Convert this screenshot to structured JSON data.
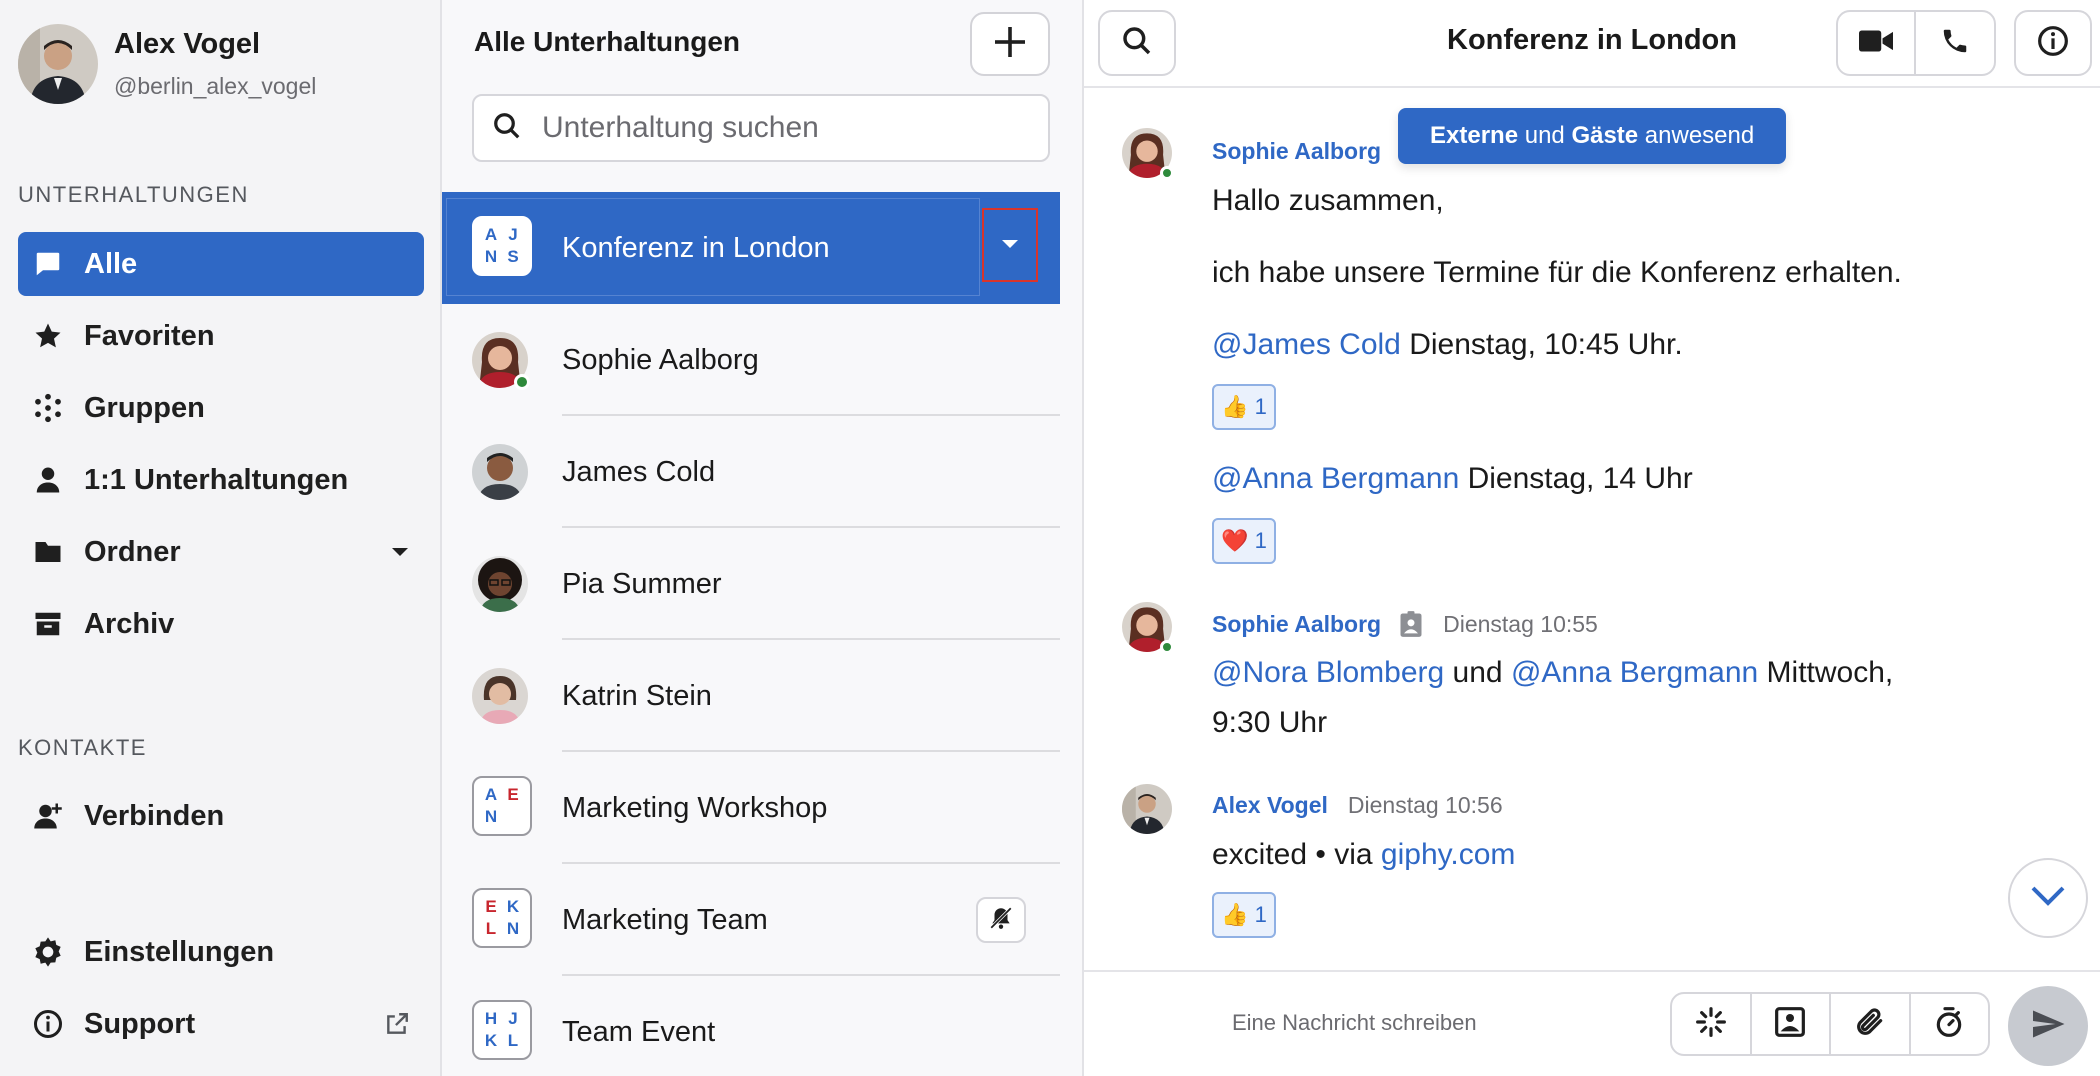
{
  "profile": {
    "name": "Alex Vogel",
    "handle": "@berlin_alex_vogel"
  },
  "sidebar": {
    "section_conversations": "UNTERHALTUNGEN",
    "items": [
      {
        "label": "Alle",
        "icon": "chat-bubble-icon",
        "active": true
      },
      {
        "label": "Favoriten",
        "icon": "star-icon"
      },
      {
        "label": "Gruppen",
        "icon": "groups-icon"
      },
      {
        "label": "1:1 Unterhaltungen",
        "icon": "person-icon"
      },
      {
        "label": "Ordner",
        "icon": "folder-icon"
      },
      {
        "label": "Archiv",
        "icon": "archive-icon"
      }
    ],
    "section_contacts": "KONTAKTE",
    "connect_label": "Verbinden",
    "settings_label": "Einstellungen",
    "support_label": "Support"
  },
  "conversations": {
    "header": "Alle Unterhaltungen",
    "search_placeholder": "Unterhaltung suchen",
    "items": [
      {
        "name": "Konferenz in London",
        "type": "group",
        "initials": [
          "A",
          "J",
          "N",
          "S"
        ],
        "active": true
      },
      {
        "name": "Sophie Aalborg",
        "type": "person",
        "online": true
      },
      {
        "name": "James Cold",
        "type": "person"
      },
      {
        "name": "Pia Summer",
        "type": "person"
      },
      {
        "name": "Katrin Stein",
        "type": "person"
      },
      {
        "name": "Marketing Workshop",
        "type": "group",
        "initials": [
          "A",
          "E",
          "N",
          ""
        ]
      },
      {
        "name": "Marketing Team",
        "type": "group",
        "initials": [
          "E",
          "K",
          "L",
          "N"
        ],
        "muted": true
      },
      {
        "name": "Team Event",
        "type": "group",
        "initials": [
          "H",
          "J",
          "K",
          "L"
        ]
      }
    ]
  },
  "chat": {
    "title": "Konferenz in London",
    "banner": {
      "part1": "Externe",
      "part2": " und ",
      "part3": "Gäste",
      "part4": " anwesend"
    },
    "messages": {
      "m1": {
        "author": "Sophie Aalborg",
        "line1": "Hallo zusammen,",
        "line2": "ich habe unsere Termine für die Konferenz erhalten.",
        "line3_mention": "@James Cold",
        "line3_text": " Dienstag, 10:45 Uhr.",
        "reaction1": {
          "emoji": "👍",
          "count": "1"
        },
        "line4_mention": "@Anna Bergmann",
        "line4_text": " Dienstag, 14 Uhr",
        "reaction2": {
          "emoji": "❤️",
          "count": "1"
        }
      },
      "m2": {
        "author": "Sophie Aalborg",
        "time": "Dienstag 10:55",
        "mention1": "@Nora Blomberg",
        "text1": " und ",
        "mention2": "@Anna Bergmann",
        "text2": " Mittwoch,",
        "line2": "9:30 Uhr"
      },
      "m3": {
        "author": "Alex Vogel",
        "time": "Dienstag 10:56",
        "text": "excited • via ",
        "link": "giphy.com",
        "reaction": {
          "emoji": "👍",
          "count": "1"
        }
      }
    },
    "composer_placeholder": "Eine Nachricht schreiben"
  },
  "colors": {
    "accent": "#2f68c5",
    "online": "#2e8a3b",
    "initial_red": "#c8262e"
  }
}
